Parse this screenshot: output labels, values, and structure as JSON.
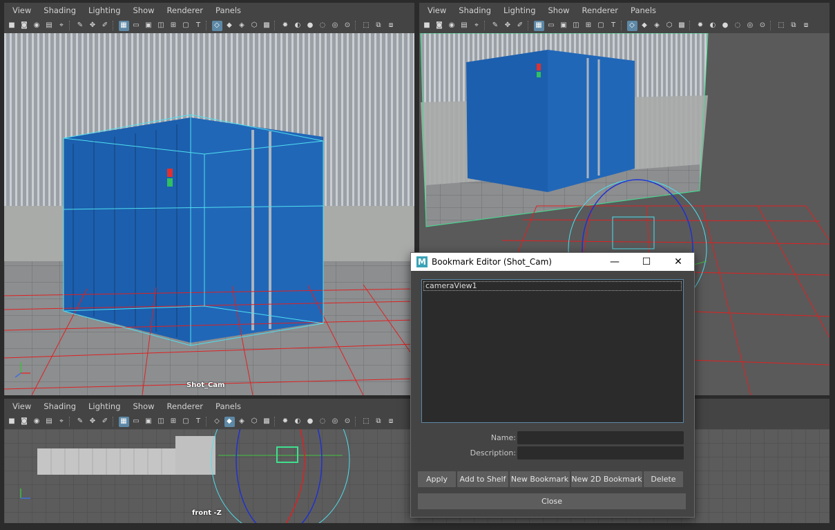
{
  "menus": [
    "View",
    "Shading",
    "Lighting",
    "Show",
    "Renderer",
    "Panels"
  ],
  "viewports": {
    "top_left": {
      "camera_label": "Shot_Cam"
    },
    "top_right": {
      "camera_label": ""
    },
    "bottom_left": {
      "camera_label": "front -Z"
    }
  },
  "axis": {
    "x": "x",
    "y": "y",
    "z": "z"
  },
  "dialog": {
    "title": "Bookmark Editor (Shot_Cam)",
    "controls": {
      "minimize": "—",
      "maximize": "☐",
      "close": "✕"
    },
    "bookmarks": [
      "cameraView1"
    ],
    "name_label": "Name:",
    "name_value": "",
    "description_label": "Description:",
    "description_value": "",
    "buttons": {
      "apply": "Apply",
      "add_to_shelf": "Add to Shelf",
      "new_bookmark": "New Bookmark",
      "new_2d_bookmark": "New 2D Bookmark",
      "delete": "Delete",
      "close": "Close"
    }
  },
  "colors": {
    "accent": "#5d88a6",
    "grid_red": "#e02020",
    "bbox_cyan": "#4fe0f0",
    "container_blue": "#1c5fae"
  }
}
